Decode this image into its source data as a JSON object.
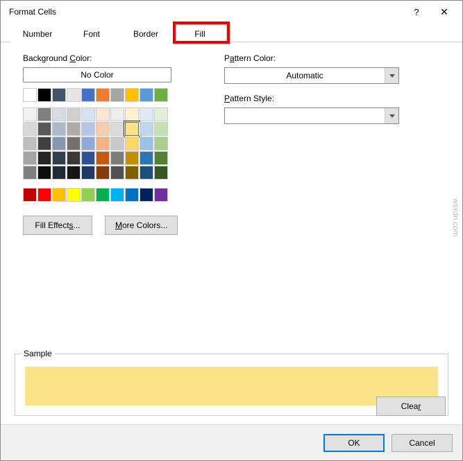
{
  "window": {
    "title": "Format Cells",
    "help": "?",
    "close": "✕"
  },
  "tabs": {
    "number": "Number",
    "font": "Font",
    "border": "Border",
    "fill": "Fill",
    "active": "fill"
  },
  "labels": {
    "background_color_pre": "Background ",
    "background_color_u": "C",
    "background_color_post": "olor:",
    "no_color": "No Color",
    "pattern_color_pre": "P",
    "pattern_color_u": "a",
    "pattern_color_post": "ttern Color:",
    "pattern_style_u": "P",
    "pattern_style_post": "attern Style:",
    "sample": "Sample",
    "fill_effects": "Fill Effects...",
    "more_colors": "More Colors...",
    "clear": "Clear",
    "ok": "OK",
    "cancel": "Cancel"
  },
  "pattern_color_value": "Automatic",
  "pattern_style_value": "",
  "sample_color": "#fce38a",
  "selected_swatch_index": 27,
  "theme_colors_row1": [
    "#ffffff",
    "#000000",
    "#44546a",
    "#e7e6e6",
    "#4472c4",
    "#ed7d31",
    "#a5a5a5",
    "#ffc000",
    "#5b9bd5",
    "#70ad47"
  ],
  "theme_colors_grid": [
    [
      "#f2f2f2",
      "#808080",
      "#d6dce4",
      "#d0cece",
      "#d9e2f3",
      "#fbe5d5",
      "#ededed",
      "#fff2cc",
      "#deebf6",
      "#e2efd9"
    ],
    [
      "#d8d8d8",
      "#595959",
      "#adb9ca",
      "#aeabab",
      "#b4c6e7",
      "#f7cbac",
      "#dbdbdb",
      "#fce38a",
      "#bdd7ee",
      "#c5e0b3"
    ],
    [
      "#bfbfbf",
      "#3f3f3f",
      "#8496b0",
      "#757070",
      "#8eaadb",
      "#f4b183",
      "#c9c9c9",
      "#ffd965",
      "#9cc3e5",
      "#a8d08d"
    ],
    [
      "#a5a5a5",
      "#262626",
      "#323f4f",
      "#3a3838",
      "#2f5496",
      "#c55a11",
      "#7b7b7b",
      "#bf9000",
      "#2e75b5",
      "#538135"
    ],
    [
      "#7f7f7f",
      "#0c0c0c",
      "#222a35",
      "#171616",
      "#1f3864",
      "#833c0b",
      "#525252",
      "#7f6000",
      "#1e4e79",
      "#375623"
    ]
  ],
  "standard_colors": [
    "#c00000",
    "#ff0000",
    "#ffc000",
    "#ffff00",
    "#92d050",
    "#00b050",
    "#00b0f0",
    "#0070c0",
    "#002060",
    "#7030a0"
  ],
  "watermark": "wsxdn.com"
}
